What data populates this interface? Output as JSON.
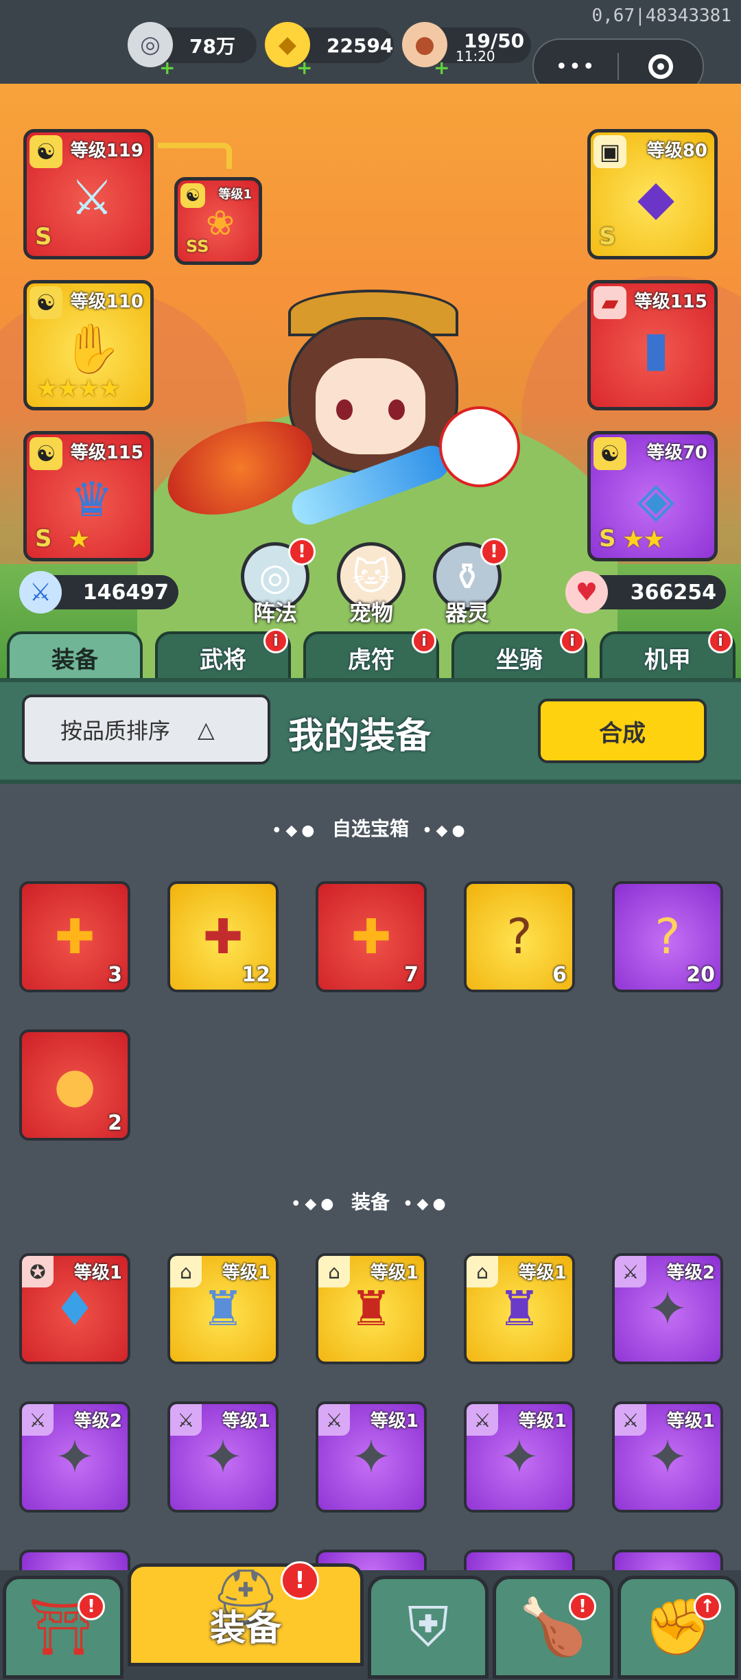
{
  "status": {
    "version": "0,67|48343381"
  },
  "currencies": [
    {
      "icon": "silver-coin-icon",
      "value": "78万"
    },
    {
      "icon": "gold-ingot-icon",
      "value": "22594"
    },
    {
      "icon": "meat-stamina-icon",
      "value": "19/50",
      "timer": "11:20"
    }
  ],
  "capsule": {
    "menu": "•••",
    "close": "close-mini-program"
  },
  "equipped": {
    "left": [
      {
        "level": "等级119",
        "grade": "S",
        "color": "red",
        "icon": "ice-sword-icon",
        "badge": "yin-yang-icon"
      },
      {
        "level": "等级110",
        "grade": "S",
        "stars": "★★★★",
        "color": "yellow",
        "icon": "ice-gauntlet-icon",
        "badge": "yin-yang-icon"
      },
      {
        "level": "等级115",
        "grade": "S",
        "stars": "★",
        "color": "red",
        "icon": "ice-helmet-icon",
        "badge": "yin-yang-icon"
      }
    ],
    "linked": {
      "level": "等级1",
      "grade": "SS",
      "icon": "phoenix-fan-icon"
    },
    "right": [
      {
        "level": "等级80",
        "grade": "S",
        "color": "yellow",
        "icon": "purple-armor-icon",
        "badge": "armor-icon"
      },
      {
        "level": "等级115",
        "grade": "",
        "color": "red",
        "icon": "blue-boots-icon",
        "badge": "boot-icon"
      },
      {
        "level": "等级70",
        "grade": "S",
        "stars": "★★",
        "color": "purple",
        "icon": "ice-armor-icon",
        "badge": "yin-yang-icon"
      }
    ]
  },
  "stats": {
    "attack": "146497",
    "hp": "366254"
  },
  "features": [
    {
      "label": "阵法",
      "alert": "!"
    },
    {
      "label": "宠物"
    },
    {
      "label": "器灵",
      "alert": "!"
    }
  ],
  "tabs": [
    {
      "label": "装备",
      "active": true
    },
    {
      "label": "武将",
      "alert": "i"
    },
    {
      "label": "虎符",
      "alert": "i"
    },
    {
      "label": "坐骑",
      "alert": "i"
    },
    {
      "label": "机甲",
      "alert": "i"
    }
  ],
  "header": {
    "sort_label": "按品质排序",
    "sort_arrow": "△",
    "title": "我的装备",
    "merge_label": "合成"
  },
  "chest_section": {
    "title": "自选宝箱",
    "dots": "•◆●"
  },
  "chests": [
    {
      "count": "3",
      "color": "red",
      "icon": "puzzle-chest-icon"
    },
    {
      "count": "12",
      "color": "yellow",
      "icon": "puzzle-chest-icon"
    },
    {
      "count": "7",
      "color": "red",
      "icon": "puzzle-chest-icon"
    },
    {
      "count": "6",
      "color": "yellow",
      "icon": "mystery-chest-icon"
    },
    {
      "count": "20",
      "color": "purple",
      "icon": "mystery-chest-icon"
    },
    {
      "count": "2",
      "color": "red",
      "icon": "lucky-bag-icon"
    }
  ],
  "equip_section": {
    "title": "装备",
    "dots": "•◆●"
  },
  "equipment": [
    {
      "level": "等级1",
      "color": "red",
      "icon": "amulet-icon",
      "badge": "medal-icon"
    },
    {
      "level": "等级1",
      "color": "yellow",
      "icon": "blue-helmet-icon",
      "badge": "helmet-icon"
    },
    {
      "level": "等级1",
      "color": "yellow",
      "icon": "red-helmet-icon",
      "badge": "helmet-icon"
    },
    {
      "level": "等级1",
      "color": "yellow",
      "icon": "gold-helmet-icon",
      "badge": "helmet-icon"
    },
    {
      "level": "等级2",
      "color": "purple",
      "icon": "shuriken-icon",
      "badge": "sword-icon"
    },
    {
      "level": "等级2",
      "color": "purple",
      "icon": "shuriken-icon",
      "badge": "sword-icon"
    },
    {
      "level": "等级1",
      "color": "purple",
      "icon": "shuriken-icon",
      "badge": "sword-icon"
    },
    {
      "level": "等级1",
      "color": "purple",
      "icon": "shuriken-icon",
      "badge": "sword-icon"
    },
    {
      "level": "等级1",
      "color": "purple",
      "icon": "shuriken-icon",
      "badge": "sword-icon"
    },
    {
      "level": "等级1",
      "color": "purple",
      "icon": "shuriken-icon",
      "badge": "sword-icon"
    }
  ],
  "bottom_nav": [
    {
      "icon": "shop-gate-icon",
      "alert": "!"
    },
    {
      "label": "装备",
      "icon": "knight-helmet-icon",
      "alert": "!",
      "active": true
    },
    {
      "icon": "battle-shield-icon"
    },
    {
      "icon": "chicken-leg-icon",
      "alert": "!"
    },
    {
      "icon": "power-fist-icon",
      "alert": "↑"
    }
  ]
}
